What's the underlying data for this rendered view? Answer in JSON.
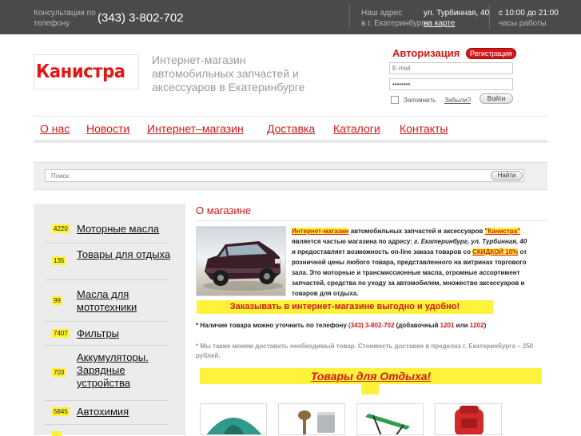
{
  "topbar": {
    "consult_label": "Консультации по\nтелефону",
    "phone": "(343) 3-802-702",
    "address_label": "Наш адрес\nв г. Екатеринбурге",
    "address_street": "ул. Турбинная, 40",
    "map_link": "на карте",
    "hours": "с 10:00 до 21:00",
    "hours_label": "часы работы"
  },
  "header": {
    "logo_text": "Канистра",
    "tagline": "Интернет-магазин автомобильных запчастей и аксессуаров в Екатеринбурге"
  },
  "auth": {
    "title": "Авторизация",
    "register_label": "Регистрация",
    "email_placeholder": "E-mail",
    "password_value": "••••••••",
    "remember_label": "Запомнить",
    "forgot_label": "Забыли?",
    "login_label": "Войти"
  },
  "nav": {
    "items": [
      "О нас",
      "Новости",
      "Интернет–магазин",
      "Доставка",
      "Каталоги",
      "Контакты"
    ]
  },
  "search": {
    "placeholder": "Поиск",
    "button_label": "Найти"
  },
  "sidebar": {
    "items": [
      {
        "count": "4220",
        "label": "Моторные масла"
      },
      {
        "count": "135",
        "label": "Товары для отдыха"
      },
      {
        "count": "99",
        "label": "Масла для мототехники"
      },
      {
        "count": "7407",
        "label": "Фильтры"
      },
      {
        "count": "703",
        "label": "Аккумуляторы. Зарядные устройства"
      },
      {
        "count": "5845",
        "label": "Автохимия"
      },
      {
        "count": "",
        "label": ""
      }
    ]
  },
  "main": {
    "title": "О магазине",
    "intro_hl": "Интернет-магазин",
    "intro_1": " автомобильных запчастей и аксессуаров ",
    "intro_brand": "\"Канистра\"",
    "intro_2": " является частью магазина по адресу: ",
    "intro_addr": "г. Екатеринбург, ул. Турбинная, 40",
    "intro_3": " и предоставляет возможность on-line заказа товаров со ",
    "intro_discount": "СКИДКОЙ 10%",
    "intro_4": " от розничной цены любого товара, представленного на витринах торгового зала. Это моторные и трансмиссионные масла, огромные ассортимент запчастей, средства по уходу за автомобилем, множество аксессуаров и товаров для отдыха.",
    "promo": "Заказывать в интернет-магазине выгодно и удобно!",
    "avail_1": "* Наличие товара можно уточнить по телефону ",
    "avail_phone": "(343) 3-802-702",
    "avail_2": " (добавочный ",
    "avail_ext1": "1201",
    "avail_3": " или ",
    "avail_ext2": "1202",
    "avail_4": ")",
    "delivery": "* Мы также можем доставить необходимый товар. Стоимость доставки в пределах г. Екатеринбурга – 250 рублей.",
    "rest_banner": "Товары для Отдыха!"
  }
}
